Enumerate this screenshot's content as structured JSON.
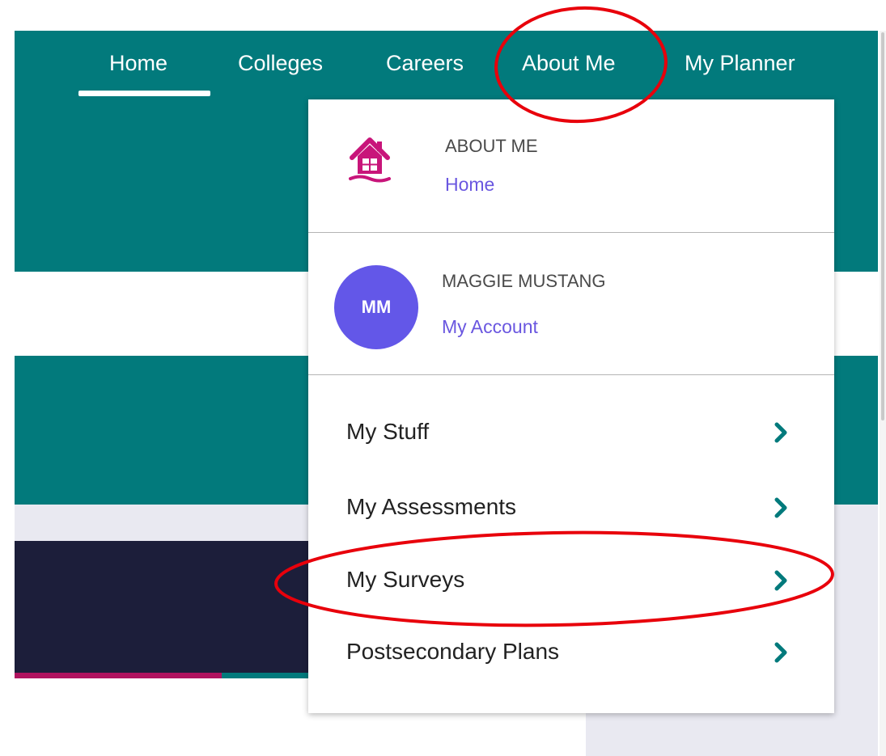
{
  "nav": {
    "items": [
      {
        "label": "Home"
      },
      {
        "label": "Colleges"
      },
      {
        "label": "Careers"
      },
      {
        "label": "About Me"
      },
      {
        "label": "My Planner"
      }
    ]
  },
  "dropdown": {
    "section_heading": "ABOUT ME",
    "home_link": "Home",
    "user_name": "MAGGIE MUSTANG",
    "avatar_initials": "MM",
    "account_link": "My Account",
    "menu_items": [
      {
        "label": "My Stuff"
      },
      {
        "label": "My Assessments"
      },
      {
        "label": "My Surveys"
      },
      {
        "label": "Postsecondary Plans"
      }
    ]
  },
  "icons": {
    "house": "house-icon",
    "chevron": "chevron-right-icon"
  },
  "colors": {
    "teal": "#027a7c",
    "navy": "#1c1e3a",
    "magenta": "#b0135f",
    "accent_link": "#6a57e0",
    "avatar": "#6357e8",
    "annotation": "#e8000b"
  }
}
